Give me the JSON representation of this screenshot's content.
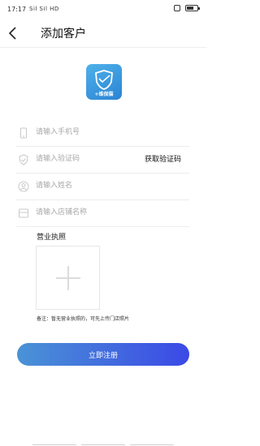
{
  "status": {
    "time": "17:17",
    "signal": "Sil Sil HD"
  },
  "header": {
    "title": "添加客户"
  },
  "logo": {
    "label": "+维保猫"
  },
  "form": {
    "phone_placeholder": "请输入手机号",
    "code_placeholder": "请输入验证码",
    "get_code_label": "获取验证码",
    "name_placeholder": "请输入姓名",
    "shop_placeholder": "请输入店铺名称"
  },
  "license": {
    "title": "营业执照",
    "note": "备注：暂无营业执照的，可先上传门店照片"
  },
  "submit_label": "立即注册",
  "colors": {
    "accent_start": "#4a93d6",
    "accent_end": "#3b49e6",
    "logo": "#3a9be0"
  }
}
